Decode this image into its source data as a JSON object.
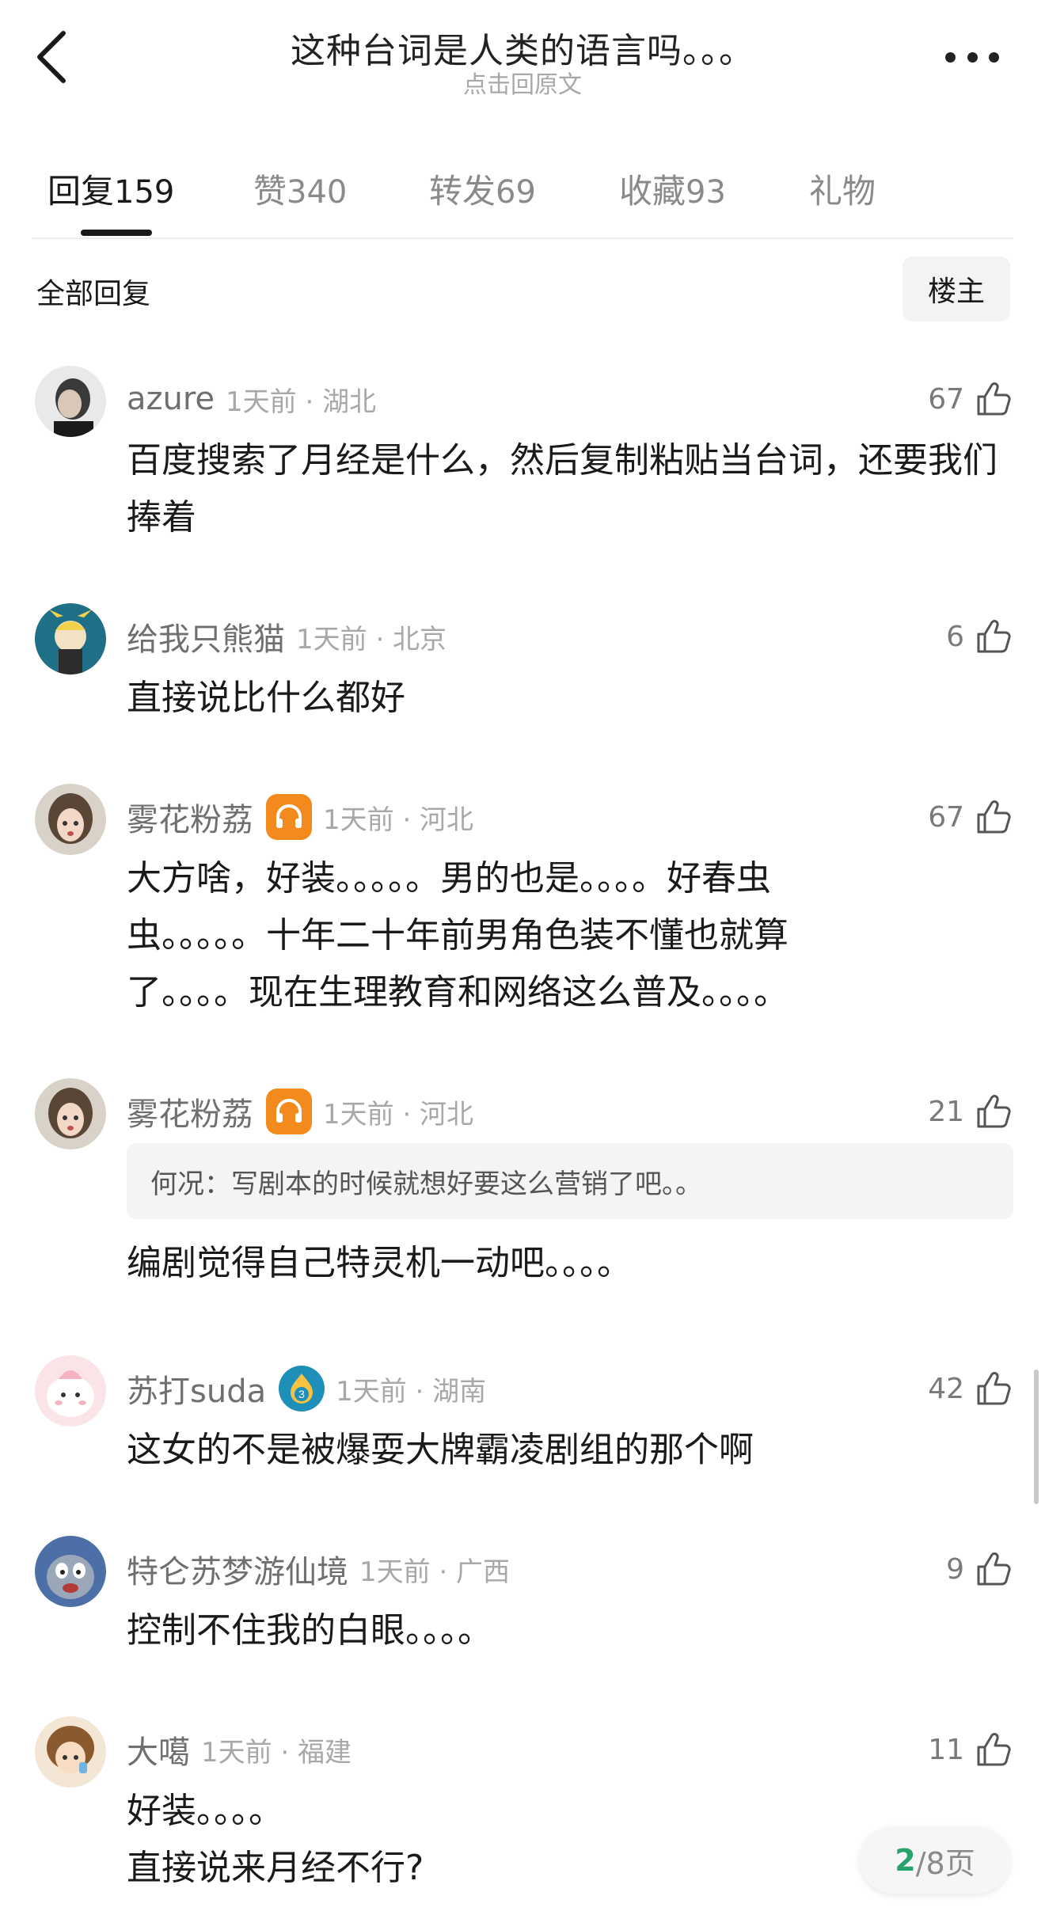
{
  "header": {
    "title": "这种台词是人类的语言吗。。。",
    "subtitle": "点击回原文"
  },
  "tabs": [
    {
      "label": "回复",
      "count": "159",
      "active": true
    },
    {
      "label": "赞",
      "count": "340"
    },
    {
      "label": "转发",
      "count": "69"
    },
    {
      "label": "收藏",
      "count": "93"
    },
    {
      "label": "礼物",
      "count": ""
    }
  ],
  "section": {
    "title": "全部回复",
    "filter": "楼主"
  },
  "comments": [
    {
      "user": "azure",
      "time": "1天前 · 湖北",
      "likes": "67",
      "text": "百度搜索了月经是什么，然后复制粘贴当台词，还要我们捧着"
    },
    {
      "user": "给我只熊猫",
      "time": "1天前 · 北京",
      "likes": "6",
      "text": "直接说比什么都好"
    },
    {
      "user": "雾花粉荔",
      "time": "1天前 · 河北",
      "likes": "67",
      "badge": "music-badge-icon",
      "text": "大方啥，好装。。。。。男的也是。。。。好春虫虫。。。。。十年二十年前男角色装不懂也就算了。。。。现在生理教育和网络这么普及。。。。"
    },
    {
      "user": "雾花粉荔",
      "time": "1天前 · 河北",
      "likes": "21",
      "badge": "music-badge-icon",
      "quote": "何况：写剧本的时候就想好要这么营销了吧。。",
      "text": "编剧觉得自己特灵机一动吧。。。。"
    },
    {
      "user": "苏打suda",
      "time": "1天前 · 湖南",
      "likes": "42",
      "badge": "level-3-badge-icon",
      "text": "这女的不是被爆耍大牌霸凌剧组的那个啊"
    },
    {
      "user": "特仑苏梦游仙境",
      "time": "1天前 · 广西",
      "likes": "9",
      "text": "控制不住我的白眼。。。。"
    },
    {
      "user": "大噶",
      "time": "1天前 · 福建",
      "likes": "11",
      "text1": "好装。。。。",
      "text2": "直接说来月经不行?"
    }
  ],
  "pager": {
    "current": "2",
    "total": "/8页"
  },
  "colors": {
    "accent_green": "#27a36b",
    "badge_orange": "#f28a1e",
    "badge_blue": "#1d8fb8"
  }
}
